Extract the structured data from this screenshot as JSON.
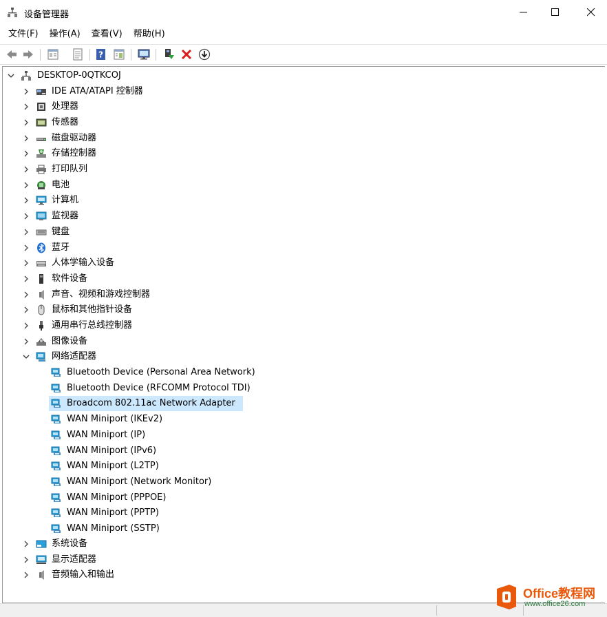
{
  "window": {
    "title": "设备管理器",
    "icon": "device-manager-icon"
  },
  "menu": [
    {
      "label": "文件(F)"
    },
    {
      "label": "操作(A)"
    },
    {
      "label": "查看(V)"
    },
    {
      "label": "帮助(H)"
    }
  ],
  "toolbar": {
    "buttons": [
      "back-arrow-icon",
      "forward-arrow-icon",
      "properties-icon",
      "update-driver-icon",
      "help-icon",
      "view-icon",
      "scan-hardware-icon",
      "enable-device-icon",
      "uninstall-icon",
      "download-icon"
    ]
  },
  "tree": {
    "root": "DESKTOP-0QTKCOJ",
    "categories_before": [
      {
        "label": "IDE ATA/ATAPI 控制器",
        "icon": "ide-controller-icon"
      },
      {
        "label": "处理器",
        "icon": "processor-icon"
      },
      {
        "label": "传感器",
        "icon": "sensor-icon"
      },
      {
        "label": "磁盘驱动器",
        "icon": "disk-drive-icon"
      },
      {
        "label": "存储控制器",
        "icon": "storage-controller-icon"
      },
      {
        "label": "打印队列",
        "icon": "printer-icon"
      },
      {
        "label": "电池",
        "icon": "battery-icon"
      },
      {
        "label": "计算机",
        "icon": "computer-icon"
      },
      {
        "label": "监视器",
        "icon": "monitor-icon"
      },
      {
        "label": "键盘",
        "icon": "keyboard-icon"
      },
      {
        "label": "蓝牙",
        "icon": "bluetooth-icon"
      },
      {
        "label": "人体学输入设备",
        "icon": "hid-icon"
      },
      {
        "label": "软件设备",
        "icon": "software-device-icon"
      },
      {
        "label": "声音、视频和游戏控制器",
        "icon": "speaker-icon"
      },
      {
        "label": "鼠标和其他指针设备",
        "icon": "mouse-icon"
      },
      {
        "label": "通用串行总线控制器",
        "icon": "usb-icon"
      },
      {
        "label": "图像设备",
        "icon": "camera-icon"
      }
    ],
    "network": {
      "label": "网络适配器",
      "icon": "network-adapter-icon",
      "children": [
        {
          "label": "Bluetooth Device (Personal Area Network)"
        },
        {
          "label": "Bluetooth Device (RFCOMM Protocol TDI)"
        },
        {
          "label": "Broadcom 802.11ac Network Adapter",
          "selected": true
        },
        {
          "label": "WAN Miniport (IKEv2)"
        },
        {
          "label": "WAN Miniport (IP)"
        },
        {
          "label": "WAN Miniport (IPv6)"
        },
        {
          "label": "WAN Miniport (L2TP)"
        },
        {
          "label": "WAN Miniport (Network Monitor)"
        },
        {
          "label": "WAN Miniport (PPPOE)"
        },
        {
          "label": "WAN Miniport (PPTP)"
        },
        {
          "label": "WAN Miniport (SSTP)"
        }
      ]
    },
    "categories_after": [
      {
        "label": "系统设备",
        "icon": "system-device-icon"
      },
      {
        "label": "显示适配器",
        "icon": "display-adapter-icon"
      },
      {
        "label": "音频输入和输出",
        "icon": "audio-io-icon"
      }
    ]
  },
  "watermark": {
    "brand": "Office教程网",
    "url": "www.office26.com"
  },
  "colors": {
    "selection": "#cce8ff",
    "adapter_icon": "#2a9fd8"
  }
}
